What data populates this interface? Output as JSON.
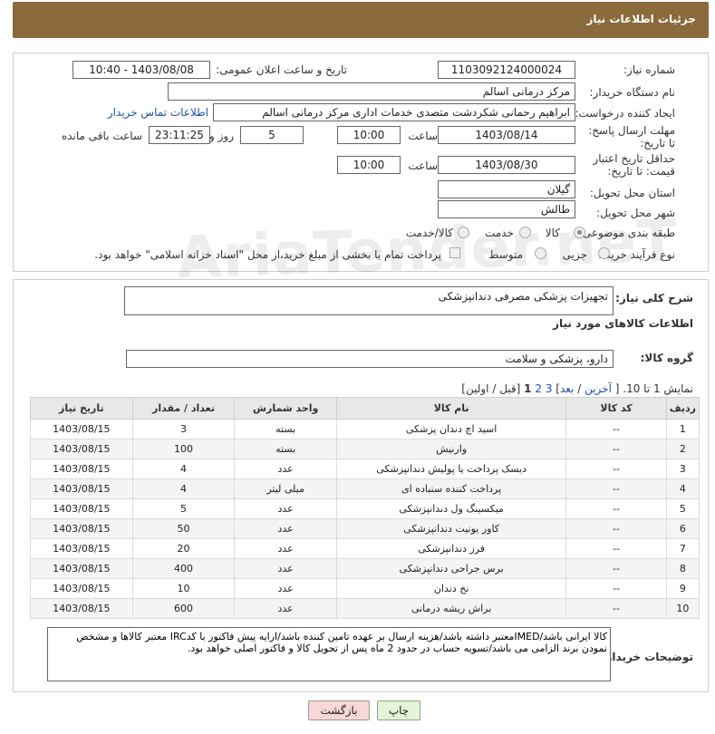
{
  "header": {
    "title": "جزئیات اطلاعات نیاز"
  },
  "form": {
    "need_number_label": "شماره نیاز:",
    "need_number": "1103092124000024",
    "announce_label": "تاریخ و ساعت اعلان عمومی:",
    "announce_value": "1403/08/08 - 10:40",
    "buyer_org_label": "نام دستگاه خریدار:",
    "buyer_org": "مرکز درمانی اسالم",
    "creator_label": "ایجاد کننده درخواست:",
    "creator": "ابراهیم رحمانی شکردشت متصدی خدمات اداری مرکز درمانی اسالم",
    "contact_link": "اطلاعات تماس خریدار",
    "deadline_label": "مهلت ارسال پاسخ: تا تاریخ:",
    "deadline_date": "1403/08/14",
    "time_label": "ساعت",
    "deadline_time": "10:00",
    "days_value": "5",
    "days_label": "روز و",
    "remaining_time": "23:11:25",
    "remaining_label": "ساعت باقی مانده",
    "price_validity_label": "حداقل تاریخ اعتبار قیمت: تا تاریخ:",
    "price_validity_date": "1403/08/30",
    "price_validity_time": "10:00",
    "province_label": "استان محل تحویل:",
    "province": "گیلان",
    "city_label": "شهر محل تحویل:",
    "city": "طالش",
    "category_label": "طبقه بندی موضوعی:",
    "category_options": [
      "کالا",
      "خدمت",
      "کالا/خدمت"
    ],
    "purchase_type_label": "نوع فرآیند خرید :",
    "purchase_options": [
      "جزیی",
      "متوسط"
    ],
    "payment_note": "پرداخت تمام یا بخشی از مبلغ خرید،از محل \"اسناد خزانه اسلامی\" خواهد بود."
  },
  "details": {
    "summary_label": "شرح کلی نیاز:",
    "summary": "تجهیزات پزشکی مصرفی دندانپزشکی",
    "goods_info_title": "اطلاعات کالاهای مورد نیاز",
    "goods_group_label": "گروه کالا:",
    "goods_group": "دارو، پزشکی و سلامت",
    "pagination_prefix": "نمایش 1 تا 10. [",
    "pagination_last": "آخرین",
    "pagination_next": "بعد",
    "pagination_pages": [
      "3",
      "2",
      "1"
    ],
    "pagination_suffix": "[قبل / اولین]"
  },
  "table": {
    "headers": [
      "ردیف",
      "کد کالا",
      "نام کالا",
      "واحد شمارش",
      "تعداد / مقدار",
      "تاریخ نیاز"
    ],
    "rows": [
      [
        "1",
        "--",
        "اسید اچ دندان پزشکی",
        "بسته",
        "3",
        "1403/08/15"
      ],
      [
        "2",
        "--",
        "وارنیش",
        "بسته",
        "100",
        "1403/08/15"
      ],
      [
        "3",
        "--",
        "دیسک پرداخت یا پولیش دندانپزشکی",
        "عدد",
        "4",
        "1403/08/15"
      ],
      [
        "4",
        "--",
        "پرداخت کننده سنباده ای",
        "میلی لیتر",
        "4",
        "1403/08/15"
      ],
      [
        "5",
        "--",
        "میکسینگ ول دندانپزشکی",
        "عدد",
        "5",
        "1403/08/15"
      ],
      [
        "6",
        "--",
        "کاور یونیت دندانپزشکی",
        "عدد",
        "50",
        "1403/08/15"
      ],
      [
        "7",
        "--",
        "فرز دندانپزشکی",
        "عدد",
        "20",
        "1403/08/15"
      ],
      [
        "8",
        "--",
        "برس جراحی دندانپزشکی",
        "عدد",
        "400",
        "1403/08/15"
      ],
      [
        "9",
        "--",
        "نخ دندان",
        "عدد",
        "10",
        "1403/08/15"
      ],
      [
        "10",
        "--",
        "براش ریشه درمانی",
        "عدد",
        "600",
        "1403/08/15"
      ]
    ]
  },
  "buyer_notes": {
    "label": "توضیحات خریدار:",
    "text": "کالا ایرانی باشد/IMEDمعتبر داشته باشد/هزینه ارسال بر عهده تامین کننده باشد/ارایه پیش فاکتور با کدIRC معتبر کالاها و مشخص نمودن برند الزامی می باشد/تسویه حساب در حدود 2 ماه پس از تحویل کالا و فاکتور اصلی خواهد بود."
  },
  "buttons": {
    "print": "چاپ",
    "back": "بازگشت"
  },
  "watermark": "AriaTender.neT",
  "colors": {
    "header": "#8b6a3c",
    "link": "#1f4fa8",
    "back_button": "#f8d7d7",
    "print_button": "#e3f5d7"
  }
}
